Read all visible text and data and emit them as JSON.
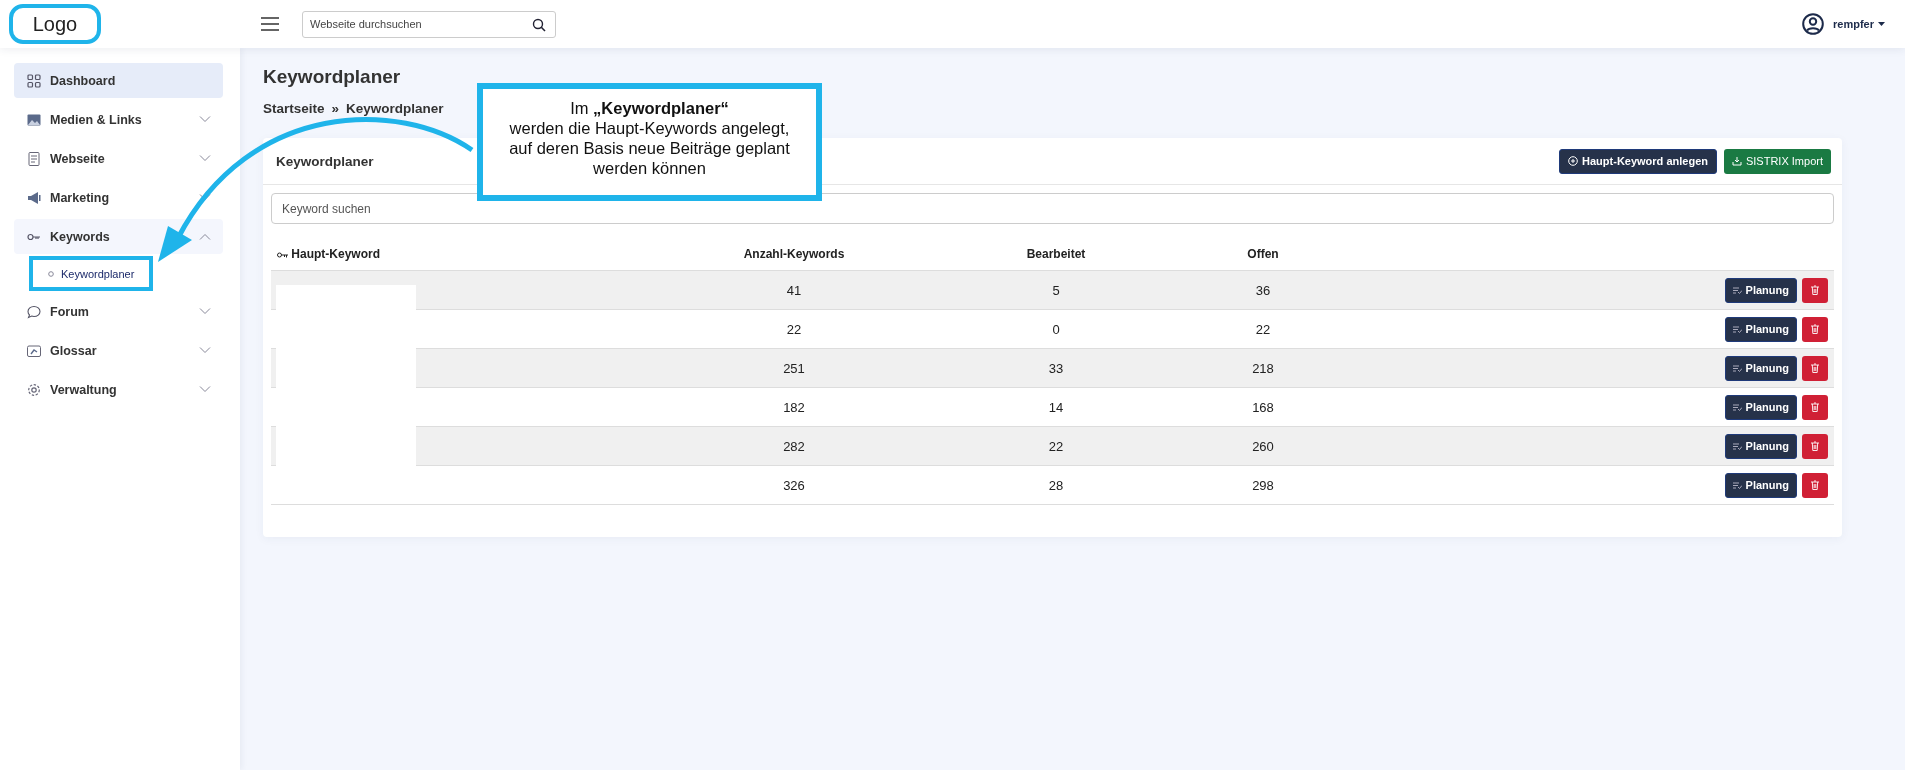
{
  "logo": {
    "text": "Logo",
    "highlighted": true
  },
  "search": {
    "placeholder": "Webseite durchsuchen"
  },
  "user": {
    "name": "rempfer"
  },
  "sidebar": {
    "items": [
      {
        "label": "Dashboard",
        "selected": true
      },
      {
        "label": "Medien & Links",
        "selected": false,
        "expanded": false
      },
      {
        "label": "Webseite",
        "selected": false,
        "expanded": false
      },
      {
        "label": "Marketing",
        "selected": false,
        "expanded": false
      },
      {
        "label": "Keywords",
        "selected": false,
        "expanded": true,
        "children": [
          {
            "label": "Keywordplaner",
            "selected": true,
            "highlighted": true
          }
        ]
      },
      {
        "label": "Forum",
        "selected": false,
        "expanded": false
      },
      {
        "label": "Glossar",
        "selected": false,
        "expanded": false
      },
      {
        "label": "Verwaltung",
        "selected": false,
        "expanded": false
      }
    ]
  },
  "page": {
    "title": "Keywordplaner",
    "breadcrumb": [
      "Startseite",
      "Keywordplaner"
    ],
    "separator": "»"
  },
  "card": {
    "title": "Keywordplaner",
    "buttons": [
      {
        "label": "Haupt-Keyword anlegen",
        "kind": "primary"
      },
      {
        "label": "SISTRIX Import",
        "kind": "success"
      }
    ],
    "search": {
      "placeholder": "Keyword suchen"
    },
    "columns": [
      "Haupt-Keyword",
      "Anzahl-Keywords",
      "Bearbeitet",
      "Offen"
    ],
    "rows": [
      {
        "redacted": true,
        "count": "41",
        "done": "5",
        "open": "36",
        "action": "Planung"
      },
      {
        "redacted": true,
        "count": "22",
        "done": "0",
        "open": "22",
        "action": "Planung"
      },
      {
        "redacted": true,
        "count": "251",
        "done": "33",
        "open": "218",
        "action": "Planung"
      },
      {
        "redacted": true,
        "count": "182",
        "done": "14",
        "open": "168",
        "action": "Planung"
      },
      {
        "redacted": true,
        "count": "282",
        "done": "22",
        "open": "260",
        "action": "Planung"
      },
      {
        "redacted": false,
        "count": "326",
        "done": "28",
        "open": "298",
        "action": "Planung"
      }
    ]
  },
  "callout": {
    "lines": [
      "Im  **„Keywordplaner“**",
      "werden die Haupt-Keywords angelegt,",
      "auf deren Basis neue Beiträge geplant",
      "werden können"
    ]
  }
}
